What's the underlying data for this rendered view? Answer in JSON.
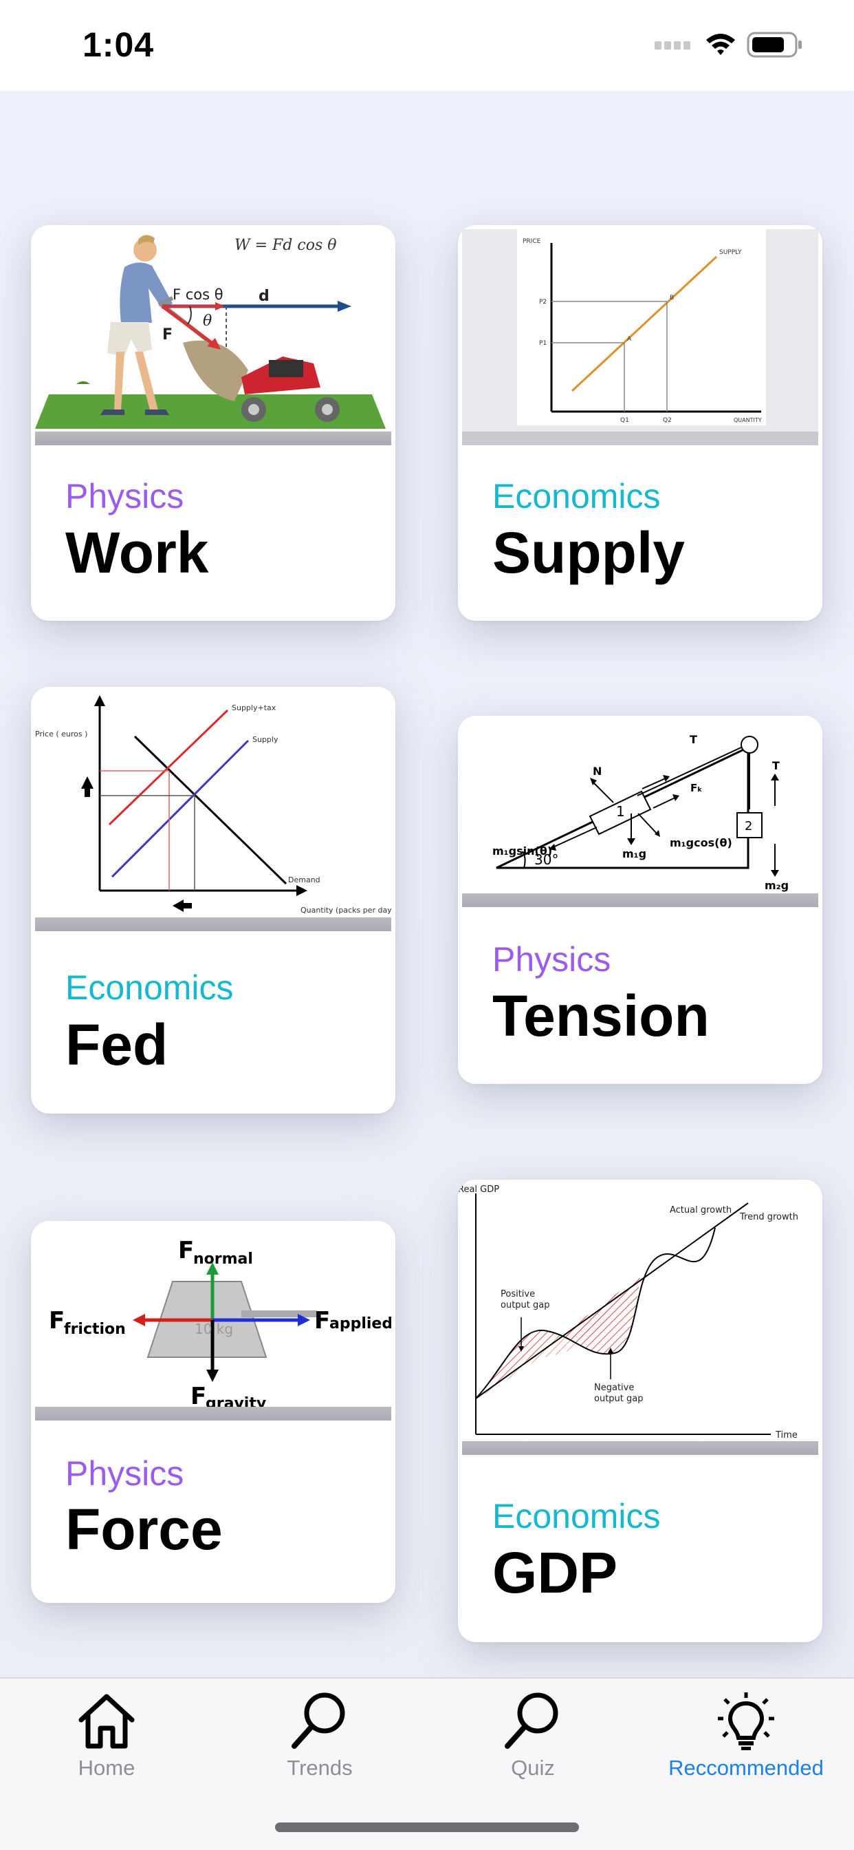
{
  "status_bar": {
    "time": "1:04",
    "icons": [
      "signal-icon",
      "wifi-icon",
      "battery-icon"
    ]
  },
  "colors": {
    "physics": "#9a5cf0",
    "economics": "#14b8cf",
    "active_tab": "#1a7ff0",
    "inactive_tab": "#8e8e93"
  },
  "cards": [
    {
      "category": "Physics",
      "title": "Work",
      "image_text": {
        "formula": "W = Fd cos θ",
        "force_label": "F cos θ",
        "d": "d",
        "f": "F",
        "theta": "θ"
      }
    },
    {
      "category": "Economics",
      "title": "Supply",
      "image_text": {
        "price": "PRICE",
        "supply": "SUPPLY",
        "p2": "P2",
        "p1": "P1",
        "a": "A",
        "b": "B",
        "q1": "Q1",
        "q2": "Q2",
        "quantity": "QUANTITY"
      }
    },
    {
      "category": "Economics",
      "title": "Fed",
      "image_text": {
        "price": "Price ( euros )",
        "supply_tax": "Supply+tax",
        "supply": "Supply",
        "demand": "Demand",
        "quantity": "Quantity (packs per day)"
      }
    },
    {
      "category": "Physics",
      "title": "Tension",
      "image_text": {
        "n": "N",
        "t1": "T",
        "t2": "T",
        "fk": "Fₖ",
        "block1": "1",
        "block2": "2",
        "m1gsin": "m₁gsin(θ)",
        "angle": "30°",
        "m1g": "m₁g",
        "m1gcos": "m₁gcos(θ)",
        "m2g": "m₂g"
      }
    },
    {
      "category": "Physics",
      "title": "Force",
      "image_text": {
        "normal_f": "F",
        "normal_sub": "normal",
        "friction_f": "F",
        "friction_sub": "friction",
        "applied_f": "F",
        "applied_sub": "applied",
        "gravity_f": "F",
        "gravity_sub": "gravity",
        "mass": "10 kg"
      }
    },
    {
      "category": "Economics",
      "title": "GDP",
      "image_text": {
        "real_gdp": "Real GDP",
        "actual": "Actual growth",
        "trend": "Trend growth",
        "positive1": "Positive",
        "positive2": "output gap",
        "negative1": "Negative",
        "negative2": "output gap",
        "time": "Time"
      }
    }
  ],
  "tabs": [
    {
      "label": "Home",
      "icon": "home-icon",
      "active": false
    },
    {
      "label": "Trends",
      "icon": "search-icon",
      "active": false
    },
    {
      "label": "Quiz",
      "icon": "search-icon",
      "active": false
    },
    {
      "label": "Reccommended",
      "icon": "lightbulb-icon",
      "active": true
    }
  ]
}
